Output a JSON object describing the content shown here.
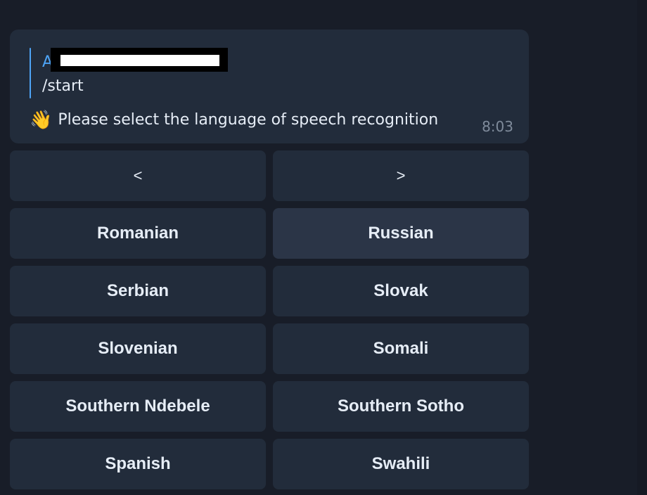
{
  "message": {
    "reply": {
      "author_visible": "A",
      "text": "/start"
    },
    "emoji": "👋",
    "text": "Please select the language of speech recognition",
    "time": "8:03"
  },
  "keyboard": {
    "prev_label": "<",
    "next_label": ">",
    "languages": [
      "Romanian",
      "Russian",
      "Serbian",
      "Slovak",
      "Slovenian",
      "Somali",
      "Southern Ndebele",
      "Southern Sotho",
      "Spanish",
      "Swahili"
    ],
    "highlighted": "Russian"
  },
  "colors": {
    "background": "#181d28",
    "bubble": "#222c3b",
    "button": "#222c3b",
    "button_highlight": "#2b3547",
    "accent": "#4ea4f6",
    "text": "#e6edf6",
    "muted": "#7f8b9b"
  }
}
